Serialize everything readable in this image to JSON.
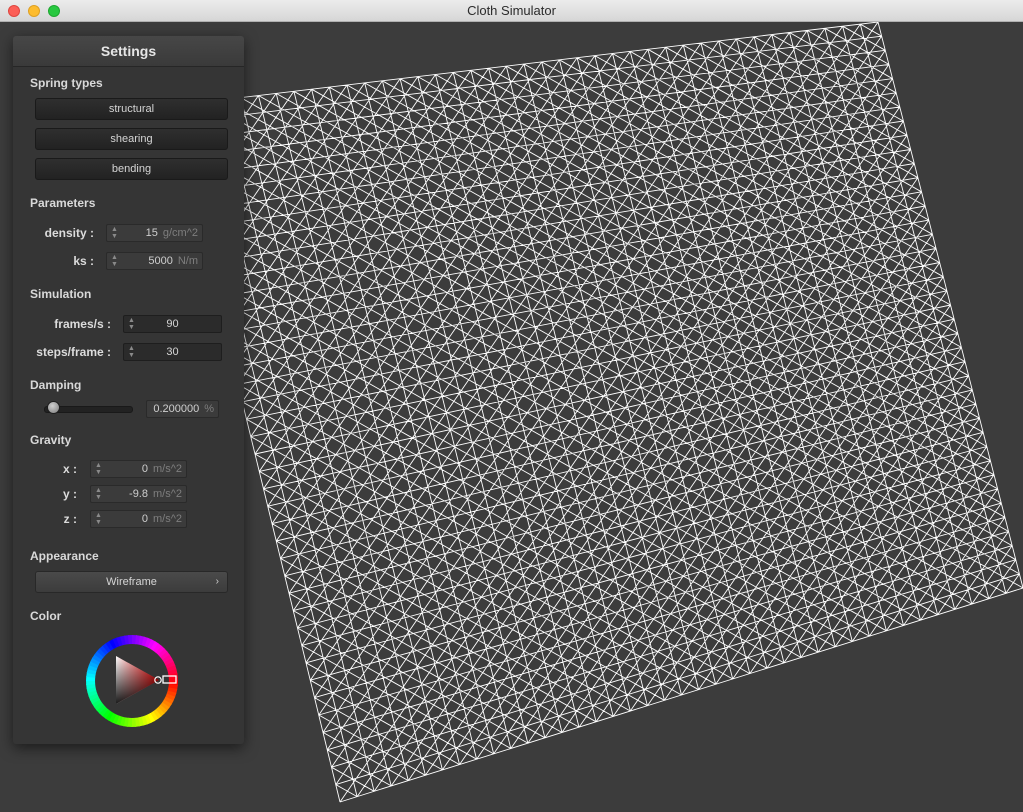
{
  "window": {
    "title": "Cloth Simulator"
  },
  "settings": {
    "header": "Settings",
    "spring_types": {
      "heading": "Spring types",
      "buttons": [
        "structural",
        "shearing",
        "bending"
      ]
    },
    "parameters": {
      "heading": "Parameters",
      "density": {
        "label": "density :",
        "value": "15",
        "unit": "g/cm^2"
      },
      "ks": {
        "label": "ks :",
        "value": "5000",
        "unit": "N/m"
      }
    },
    "simulation": {
      "heading": "Simulation",
      "frames": {
        "label": "frames/s :",
        "value": "90"
      },
      "steps": {
        "label": "steps/frame :",
        "value": "30"
      }
    },
    "damping": {
      "heading": "Damping",
      "value": "0.200000",
      "unit": "%",
      "slider_fraction": 0.2
    },
    "gravity": {
      "heading": "Gravity",
      "x": {
        "label": "x :",
        "value": "0",
        "unit": "m/s^2"
      },
      "y": {
        "label": "y :",
        "value": "-9.8",
        "unit": "m/s^2"
      },
      "z": {
        "label": "z :",
        "value": "0",
        "unit": "m/s^2"
      }
    },
    "appearance": {
      "heading": "Appearance",
      "selected": "Wireframe"
    },
    "color": {
      "heading": "Color",
      "selected_color": "#ff0000"
    }
  },
  "scene": {
    "render_mode": "wireframe",
    "background_color": "#3c3c3c",
    "mesh_color": "#ffffff"
  }
}
